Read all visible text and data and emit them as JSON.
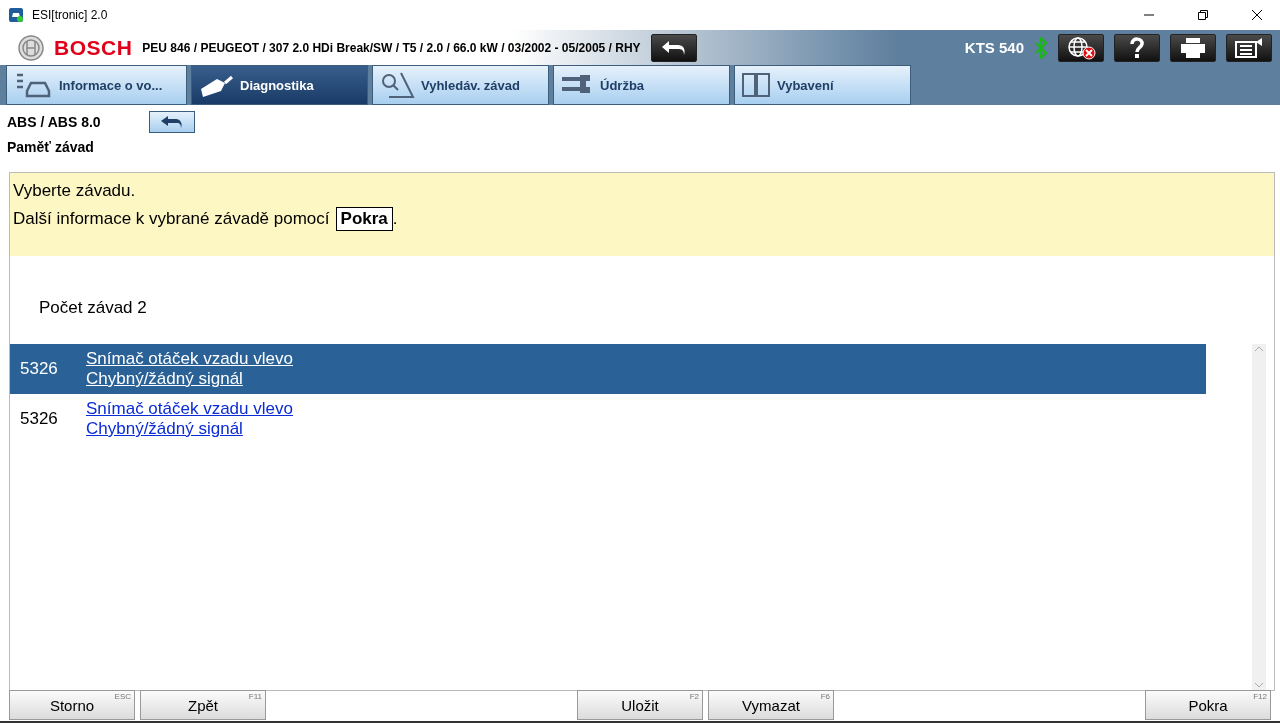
{
  "window": {
    "title": "ESI[tronic] 2.0"
  },
  "header": {
    "brand": "BOSCH",
    "vehicle": "PEU 846 / PEUGEOT / 307 2.0 HDi Break/SW / T5 / 2.0 / 66.0 kW / 03/2002 - 05/2005 / RHY",
    "device": "KTS 540"
  },
  "tabs": [
    {
      "label": "Informace o vo...",
      "selected": false
    },
    {
      "label": "Diagnostika",
      "selected": true
    },
    {
      "label": "Vyhledáv. závad",
      "selected": false
    },
    {
      "label": "Údržba",
      "selected": false
    },
    {
      "label": "Vybavení",
      "selected": false
    }
  ],
  "breadcrumb": {
    "system": "ABS / ABS 8.0",
    "section": "Paměť závad"
  },
  "info": {
    "line1": "Vyberte závadu.",
    "line2_prefix": "Další informace k vybrané závadě pomocí",
    "line2_key": "Pokra",
    "line2_suffix": "."
  },
  "fault_count": "Počet závad 2",
  "faults": [
    {
      "code": "5326",
      "description": "Snímač otáček vzadu vlevo",
      "status": "Chybný/žádný signál",
      "selected": true
    },
    {
      "code": "5326",
      "description": "Snímač otáček vzadu vlevo",
      "status": "Chybný/žádný signál",
      "selected": false
    }
  ],
  "footer_buttons": [
    {
      "label": "Storno",
      "key": "ESC"
    },
    {
      "label": "Zpět",
      "key": "F11"
    },
    {
      "label": "Uložit",
      "key": "F2"
    },
    {
      "label": "Vymazat",
      "key": "F6"
    },
    {
      "label": "Pokra",
      "key": "F12"
    }
  ]
}
